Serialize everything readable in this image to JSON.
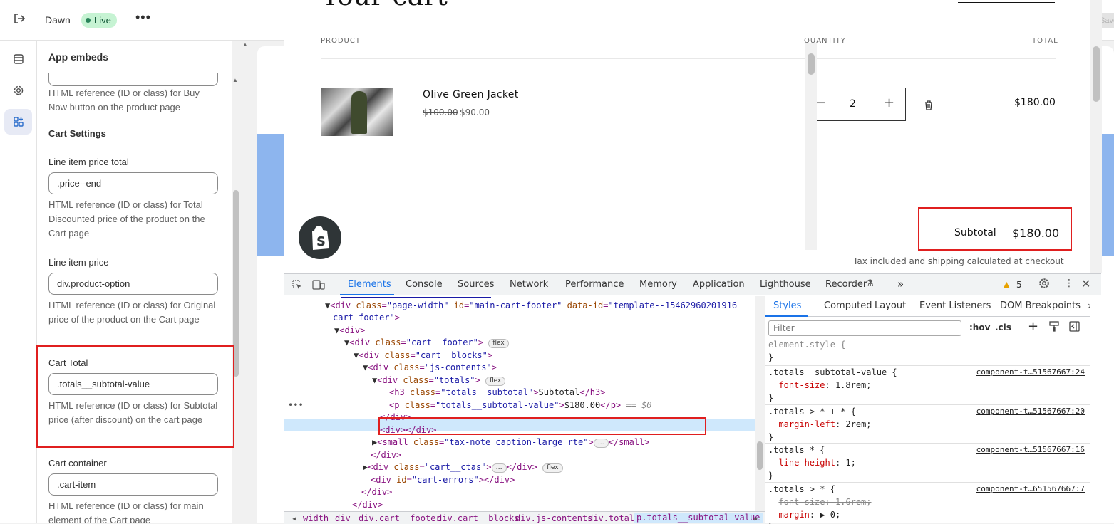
{
  "topbar": {
    "theme_name": "Dawn",
    "status": "Live",
    "more": "•••",
    "save_label": "Save"
  },
  "panel": {
    "title": "App embeds",
    "partial_help": "HTML reference (ID or class) for Buy Now button on the product page",
    "section_cart": "Cart Settings",
    "fields": [
      {
        "label": "Line item price total",
        "value": ".price--end",
        "help": "HTML reference (ID or class) for Total Discounted price of the product on the Cart page"
      },
      {
        "label": "Line item price",
        "value": "div.product-option",
        "help": "HTML reference (ID or class) for Original price of the product on the Cart page"
      },
      {
        "label": "Cart Total",
        "value": ".totals__subtotal-value",
        "help": "HTML reference (ID or class) for Subtotal price (after discount) on the cart page"
      },
      {
        "label": "Cart container",
        "value": ".cart-item",
        "help": "HTML reference (ID or class) for main element of the Cart page"
      }
    ]
  },
  "store": {
    "title": "Your cart",
    "headers": {
      "product": "PRODUCT",
      "quantity": "QUANTITY",
      "total": "TOTAL"
    },
    "item": {
      "name": "Olive Green Jacket",
      "price_old": "$100.00",
      "price_new": "$90.00",
      "quantity": "2",
      "line_total": "$180.00"
    },
    "subtotal_label": "Subtotal",
    "subtotal_value": "$180.00",
    "tax_note": "Tax included and shipping calculated at checkout"
  },
  "devtools": {
    "tabs": [
      "Elements",
      "Console",
      "Sources",
      "Network",
      "Performance",
      "Memory",
      "Application",
      "Lighthouse",
      "Recorder"
    ],
    "more_tabs": "»",
    "warnings": "5",
    "styles_tabs": [
      "Styles",
      "Computed",
      "Layout",
      "Event Listeners",
      "DOM Breakpoints"
    ],
    "filter_placeholder": "Filter",
    "hov": ":hov",
    "cls": ".cls",
    "rules": [
      {
        "selector": "element.style {",
        "props": [],
        "source": ""
      },
      {
        "selector": ".totals__subtotal-value {",
        "props": [
          {
            "name": "font-size",
            "value": "1.8rem;",
            "struck": false
          }
        ],
        "source": "component-t…51567667:24"
      },
      {
        "selector": ".totals > * + * {",
        "props": [
          {
            "name": "margin-left",
            "value": "2rem;",
            "struck": false
          }
        ],
        "source": "component-t…51567667:20"
      },
      {
        "selector": ".totals * {",
        "props": [
          {
            "name": "line-height",
            "value": "1;",
            "struck": false
          }
        ],
        "source": "component-t…51567667:16"
      },
      {
        "selector": ".totals > * {",
        "props": [
          {
            "name": "font-size",
            "value": "1.6rem;",
            "struck": true
          },
          {
            "name": "margin",
            "value": "▶ 0;",
            "struck": false
          }
        ],
        "source": "component-t…651567667:7"
      }
    ],
    "crumbs": [
      "width",
      "div",
      "div.cart__footer",
      "div.cart__blocks",
      "div.js-contents",
      "div.totals",
      "p.totals__subtotal-value"
    ],
    "selected_marker": "== $0",
    "ellipsis": "•••"
  }
}
